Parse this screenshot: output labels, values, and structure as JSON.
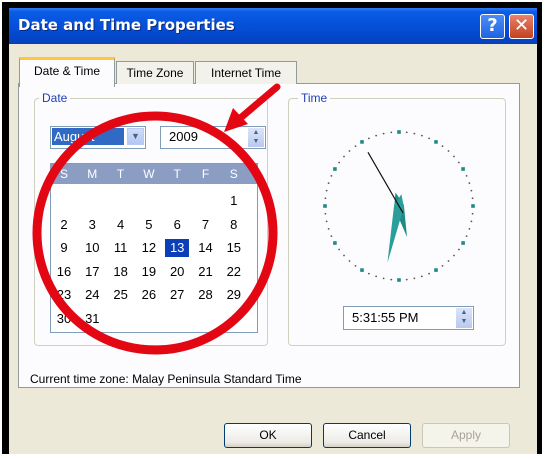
{
  "window": {
    "title": "Date and Time Properties",
    "help_glyph": "?",
    "close_glyph": "✕"
  },
  "tabs": [
    "Date & Time",
    "Time Zone",
    "Internet Time"
  ],
  "date_group": {
    "label": "Date",
    "month": "August",
    "year": "2009",
    "day_headers": [
      "S",
      "M",
      "T",
      "W",
      "T",
      "F",
      "S"
    ],
    "weeks": [
      [
        "",
        "",
        "",
        "",
        "",
        "",
        "1"
      ],
      [
        "2",
        "3",
        "4",
        "5",
        "6",
        "7",
        "8"
      ],
      [
        "9",
        "10",
        "11",
        "12",
        "13",
        "14",
        "15"
      ],
      [
        "16",
        "17",
        "18",
        "19",
        "20",
        "21",
        "22"
      ],
      [
        "23",
        "24",
        "25",
        "26",
        "27",
        "28",
        "29"
      ],
      [
        "30",
        "31",
        "",
        "",
        "",
        "",
        ""
      ]
    ],
    "selected_day": "13"
  },
  "time_group": {
    "label": "Time",
    "time_value": "5:31:55 PM",
    "clock": {
      "hour": 5,
      "minute": 31,
      "second": 55
    }
  },
  "timezone": {
    "label": "Current time zone:",
    "value": "Malay Peninsula Standard Time"
  },
  "buttons": {
    "ok": "OK",
    "cancel": "Cancel",
    "apply": "Apply"
  },
  "annotation": {
    "circle_color": "#e30613",
    "arrow_color": "#e30613"
  },
  "colors": {
    "title_bar": "#0550d8",
    "selection": "#316ac5",
    "calendar_header": "#8b9dc3",
    "clock_hands": "#1f8a86"
  }
}
